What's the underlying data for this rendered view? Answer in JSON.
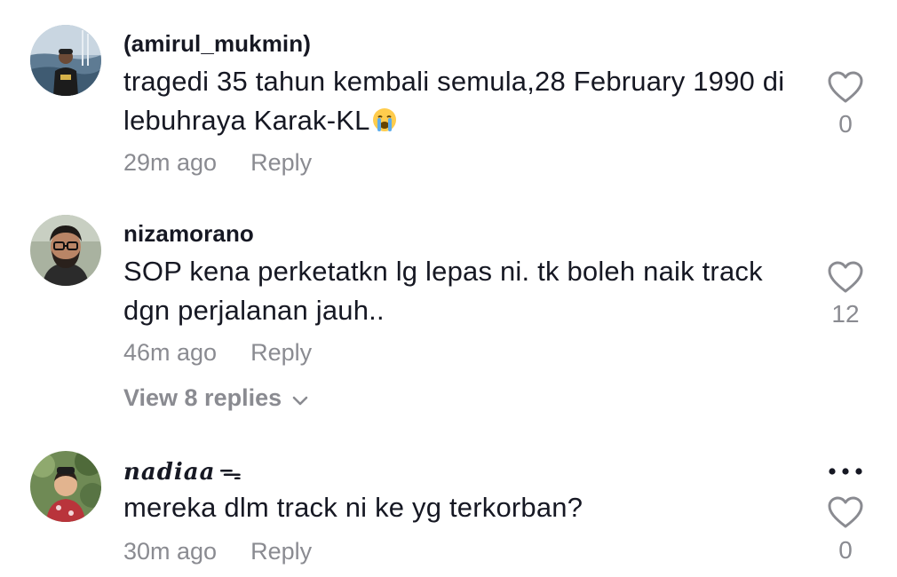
{
  "comments": [
    {
      "username": "(amirul_mukmin)",
      "text": "tragedi 35 tahun kembali semula,28 February 1990 di lebuhraya Karak-KL",
      "emoji": "loudly-crying-face",
      "time": "29m ago",
      "reply_label": "Reply",
      "likes": "0"
    },
    {
      "username": "nizamorano",
      "text": "SOP kena perketatkn lg lepas ni. tk boleh naik track dgn perjalanan jauh..",
      "time": "46m ago",
      "reply_label": "Reply",
      "likes": "12",
      "view_replies_label": "View 8 replies"
    },
    {
      "username": "nadiaa",
      "username_suffix": "ᯓ",
      "text": "mereka dlm track ni ke yg terkorban?",
      "time": "30m ago",
      "reply_label": "Reply",
      "likes": "0"
    }
  ],
  "icons": {
    "like": "heart-outline-icon",
    "more": "more-dots-icon",
    "expand": "chevron-down-icon"
  },
  "colors": {
    "text": "#161823",
    "muted": "#8a8b91",
    "background": "#ffffff"
  }
}
